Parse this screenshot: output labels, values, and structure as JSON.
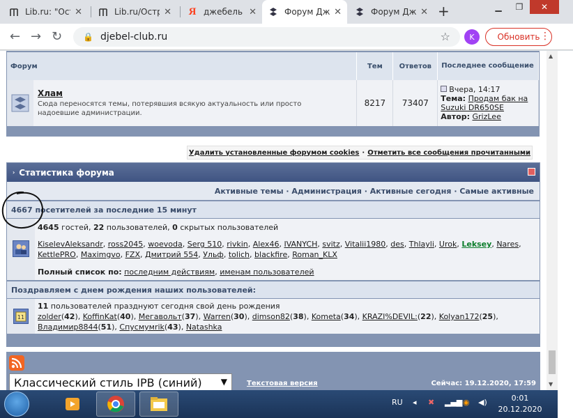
{
  "browser": {
    "tabs": [
      {
        "title": "Lib.ru: \"Ост",
        "icon": "lib-icon",
        "active": false
      },
      {
        "title": "Lib.ru/Остр",
        "icon": "lib-icon",
        "active": false
      },
      {
        "title": "джебель к",
        "icon": "yandex-icon",
        "active": false
      },
      {
        "title": "Форум Дж",
        "icon": "suzuki-icon",
        "active": true
      },
      {
        "title": "Форум Дж",
        "icon": "suzuki-icon",
        "active": false
      }
    ],
    "new_tab": "+",
    "url": "djebel-club.ru",
    "profile_letter": "K",
    "update_label": "Обновить"
  },
  "forum_table": {
    "headers": {
      "forum": "Форум",
      "topics": "Тем",
      "replies": "Ответов",
      "last_post": "Последнее сообщение"
    },
    "row": {
      "name": "Хлам",
      "description": "Сюда переносятся темы, потерявшия всякую актуальность или просто надоевшие администрации.",
      "topics": "8217",
      "replies": "73407",
      "last_time": "Вчера, 14:17",
      "topic_label": "Тема:",
      "topic_title": "Продам бак на Suzuki DR650SE",
      "author_label": "Автор:",
      "author": "GrizLee"
    }
  },
  "actions": {
    "delete_cookies": "Удалить установленные форумом cookies",
    "separator": "·",
    "mark_read": "Отметить все сообщения прочитанными"
  },
  "stats": {
    "title": "Статистика форума",
    "nav": {
      "active_topics": "Активные темы",
      "administration": "Администрация",
      "active_today": "Активные сегодня",
      "most_active": "Самые активные",
      "sep": " · "
    },
    "visitors_header": "4667 посетителей за последние 15 минут",
    "guests": "4645",
    "guests_label": " гостей, ",
    "users": "22",
    "users_label": " пользователей, ",
    "hidden": "0",
    "hidden_label": " скрытых пользователей",
    "online_users": [
      "KiselevAleksandr",
      "ross2045",
      "woevoda",
      "Serg 510",
      "rivkin",
      "Alex46",
      "IVANYCH",
      "svitz",
      "Vitalii1980",
      "des",
      "Thlayli",
      "Urok",
      "Leksey",
      "Nares",
      "KettlePRO",
      "Maximgvo",
      "FZX",
      "Дмитрий 554",
      "Ульф",
      "tolich",
      "blackfire",
      "Roman_KLX"
    ],
    "full_list_label": "Полный список по:",
    "by_last_action": "последним действиям",
    "comma": ",",
    "by_username": "именам пользователей",
    "birthday_header": "Поздравляем с днем рождения наших пользователей:",
    "birthday_count": "11",
    "birthday_text": " пользователей празднуют сегодня свой день рождения",
    "birthdays": [
      {
        "name": "zolder",
        "age": "42"
      },
      {
        "name": "KoffinKat",
        "age": "40"
      },
      {
        "name": "Мегавольт",
        "age": "37"
      },
      {
        "name": "Warren",
        "age": "30"
      },
      {
        "name": "dimson82",
        "age": "38"
      },
      {
        "name": "Kometa",
        "age": "34"
      },
      {
        "name": "KRAZI%DEVIL:",
        "age": "22"
      },
      {
        "name": "Kolyan172",
        "age": "25"
      },
      {
        "name": "Владимир8844",
        "age": "51"
      },
      {
        "name": "Спусмумrik",
        "age": "43"
      },
      {
        "name": "Natashka",
        "age": ""
      }
    ]
  },
  "footer": {
    "skin": "Классический стиль IPB (синий)",
    "text_version": "Текстовая версия",
    "now": "Сейчас: 19.12.2020, 17:59"
  },
  "taskbar": {
    "lang": "RU",
    "time": "0:01",
    "date": "20.12.2020"
  },
  "colors": {
    "accent_red": "#d93025",
    "forum_blue": "#8394b2",
    "online_green": "#0b7d2b"
  }
}
